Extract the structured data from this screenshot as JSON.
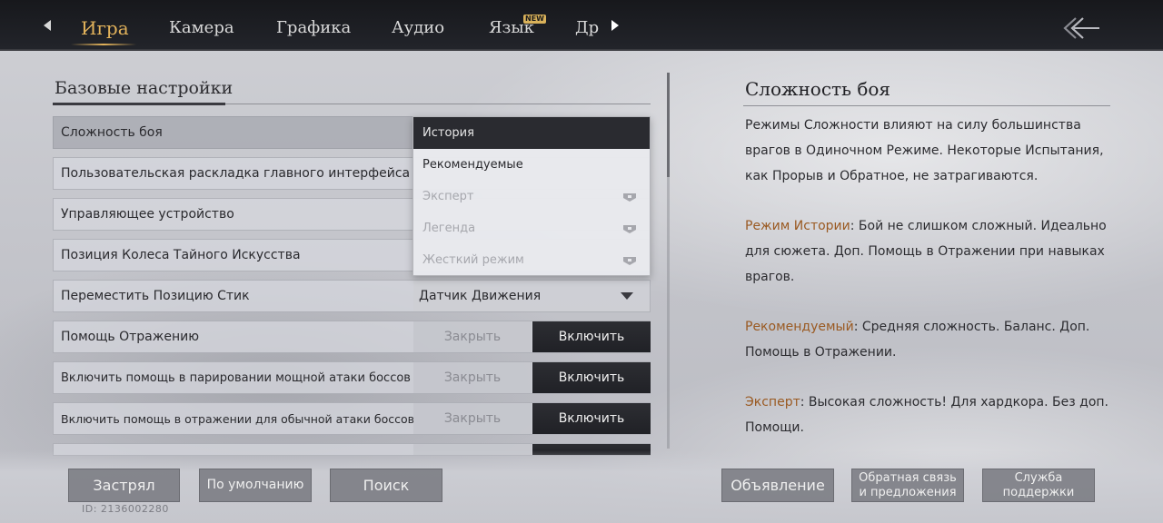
{
  "tabs": {
    "items": [
      {
        "label": "Игра",
        "active": true
      },
      {
        "label": "Камера"
      },
      {
        "label": "Графика"
      },
      {
        "label": "Аудио"
      },
      {
        "label": "Язык",
        "badge": "NEW"
      },
      {
        "label": "Др"
      }
    ]
  },
  "section": {
    "title": "Базовые настройки"
  },
  "settings": {
    "rows": [
      {
        "label": "Сложность боя"
      },
      {
        "label": "Пользовательская раскладка главного интерфейса"
      },
      {
        "label": "Управляющее устройство"
      },
      {
        "label": "Позиция Колеса Тайного Искусства"
      },
      {
        "label": "Переместить Позицию Стик",
        "value": "Датчик Движения"
      },
      {
        "label": "Помощь Отражению",
        "off": "Закрыть",
        "on": "Включить"
      },
      {
        "label": "Включить помощь в парировании мощной атаки боссов",
        "off": "Закрыть",
        "on": "Включить"
      },
      {
        "label": "Включить помощь в отражении для обычной атаки боссов",
        "off": "Закрыть",
        "on": "Включить"
      }
    ]
  },
  "dropdown": {
    "options": [
      {
        "label": "История",
        "selected": true
      },
      {
        "label": "Рекомендуемые"
      },
      {
        "label": "Эксперт",
        "locked": true
      },
      {
        "label": "Легенда",
        "locked": true
      },
      {
        "label": "Жесткий режим",
        "locked": true
      }
    ]
  },
  "description": {
    "title": "Сложность боя",
    "intro": "Режимы Сложности влияют на силу большинства врагов в Одиночном Режиме. Некоторые Испытания, как Прорыв и Обратное, не затрагиваются.",
    "story_label": "Режим Истории",
    "story_text": ": Бой не слишком сложный. Идеально для сюжета. Доп. Помощь в Отражении при навыках врагов.",
    "rec_label": "Рекомендуемый",
    "rec_text": ": Средняя сложность. Баланс. Доп. Помощь в Отражении.",
    "expert_label": "Эксперт",
    "expert_text": ": Высокая сложность! Для хардкора. Без доп. Помощи."
  },
  "buttons": {
    "stuck": "Застрял",
    "default": "По умолчанию",
    "search": "Поиск",
    "announcement": "Объявление",
    "feedback_1": "Обратная связь",
    "feedback_2": "и предложения",
    "support_1": "Служба",
    "support_2": "поддержки"
  },
  "user": {
    "id": "ID: 2136002280"
  },
  "colors": {
    "accent_gold": "#e3b35b",
    "accent_brown": "#9a5a22",
    "warn_red": "#c0392b"
  }
}
